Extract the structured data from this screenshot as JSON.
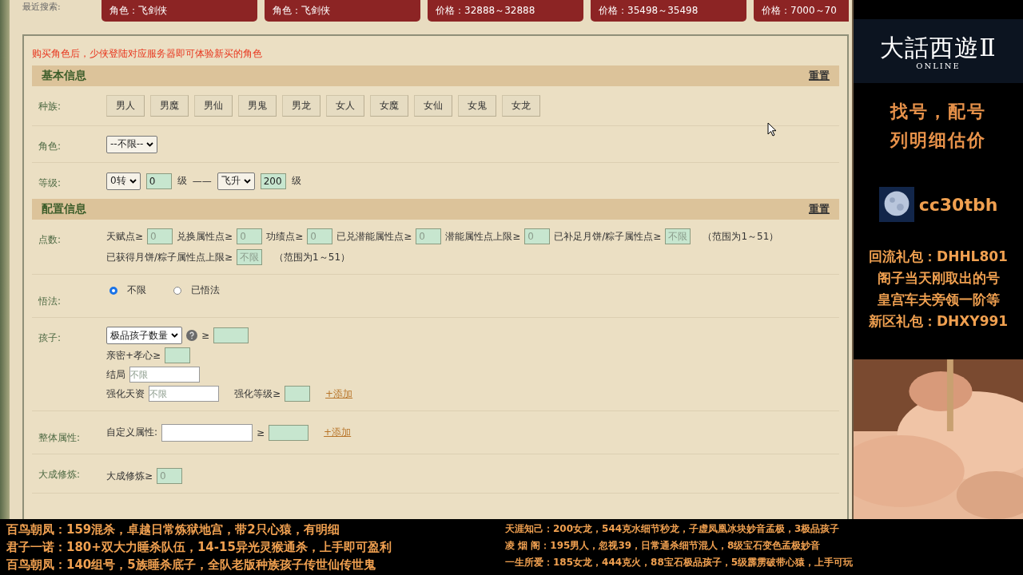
{
  "recent_search": {
    "label": "最近搜索:",
    "items": [
      "角色：飞剑侠",
      "角色：飞剑侠",
      "价格：32888～32888",
      "价格：35498～35498",
      "价格：7000～70"
    ]
  },
  "notice": "购买角色后，少侠登陆对应服务器即可体验新买的角色",
  "basic": {
    "title": "基本信息",
    "reset": "重置",
    "race": {
      "label": "种族:",
      "options": [
        {
          "label": "男人",
          "selected": false
        },
        {
          "label": "男魔",
          "selected": false
        },
        {
          "label": "男仙",
          "selected": false
        },
        {
          "label": "男鬼",
          "selected": false
        },
        {
          "label": "男龙",
          "selected": false
        },
        {
          "label": "女人",
          "selected": false
        },
        {
          "label": "女魔",
          "selected": false
        },
        {
          "label": "女仙",
          "selected": false
        },
        {
          "label": "女鬼",
          "selected": false
        },
        {
          "label": "女龙",
          "selected": false
        }
      ]
    },
    "role": {
      "label": "角色:",
      "select": "--不限--"
    },
    "level": {
      "label": "等级:",
      "from_select": "0转",
      "from_value": "0",
      "from_unit": "级",
      "dash": "——",
      "to_select": "飞升",
      "to_value": "200",
      "to_unit": "级"
    }
  },
  "config": {
    "title": "配置信息",
    "reset": "重置",
    "points": {
      "label": "点数:",
      "lines": [
        {
          "items": [
            {
              "label": "天赋点≥",
              "placeholder": "0"
            },
            {
              "label": "兑换属性点≥",
              "placeholder": "0"
            },
            {
              "label": "功绩点≥",
              "placeholder": "0"
            },
            {
              "label": "已兑潜能属性点≥",
              "placeholder": "0"
            },
            {
              "label": "潜能属性点上限≥",
              "placeholder": "0"
            },
            {
              "label": "已补足月饼/粽子属性点≥",
              "placeholder": "不限"
            }
          ],
          "note": "（范围为1～51）"
        },
        {
          "items": [
            {
              "label": "已获得月饼/粽子属性点上限≥",
              "placeholder": "不限"
            }
          ],
          "note": "（范围为1～51）"
        }
      ]
    },
    "enlightenment": {
      "label": "悟法:",
      "options": [
        {
          "label": "不限",
          "selected": true
        },
        {
          "label": "已悟法",
          "selected": false
        }
      ]
    },
    "children": {
      "label": "孩子:",
      "select": "极品孩子数量",
      "ge": "≥",
      "intimacy": "亲密+孝心≥",
      "ending": "结局",
      "ending_placeholder": "不限",
      "talent": "强化天资",
      "talent_placeholder": "不限",
      "enhance": "强化等级≥",
      "add": "+添加"
    },
    "overall": {
      "label": "整体属性:",
      "custom": "自定义属性:",
      "ge": "≥",
      "add": "+添加"
    },
    "cultivation": {
      "label": "大成修炼:",
      "field": "大成修炼≥",
      "placeholder": "0"
    }
  },
  "side": {
    "logo": "大話西遊Ⅱ",
    "logo_sub": "ONLINE",
    "slogan": [
      "找号，配号",
      "列明细估价"
    ],
    "handle": "cc30tbh",
    "promo": [
      "回流礼包：DHHL801",
      "阁子当天刚取出的号",
      "皇宫车夫旁领一阶等",
      "新区礼包：DHXY991"
    ]
  },
  "ticker": {
    "left": [
      "百鸟朝凤：159混杀，卓越日常炼狱地宫，带2只心猿，有明细",
      "君子一诺：180+双大力睡杀队伍，14-15异光灵猴通杀，上手即可盈利",
      "百鸟朝凤：140组号，5族睡杀底子，全队老版种族孩子传世仙传世鬼"
    ],
    "right": [
      "天涯知己：200女龙，544克水细节秒龙，子虚凤凰冰块妙音孟极，3极品孩子",
      "凌 烟 阁：195男人，忽视39，日常通杀细节混人，8级宝石变色孟极妙音",
      "一生所爱：185女龙，444克火，88宝石极品孩子，5级霹雳破带心猿，上手可玩"
    ]
  }
}
